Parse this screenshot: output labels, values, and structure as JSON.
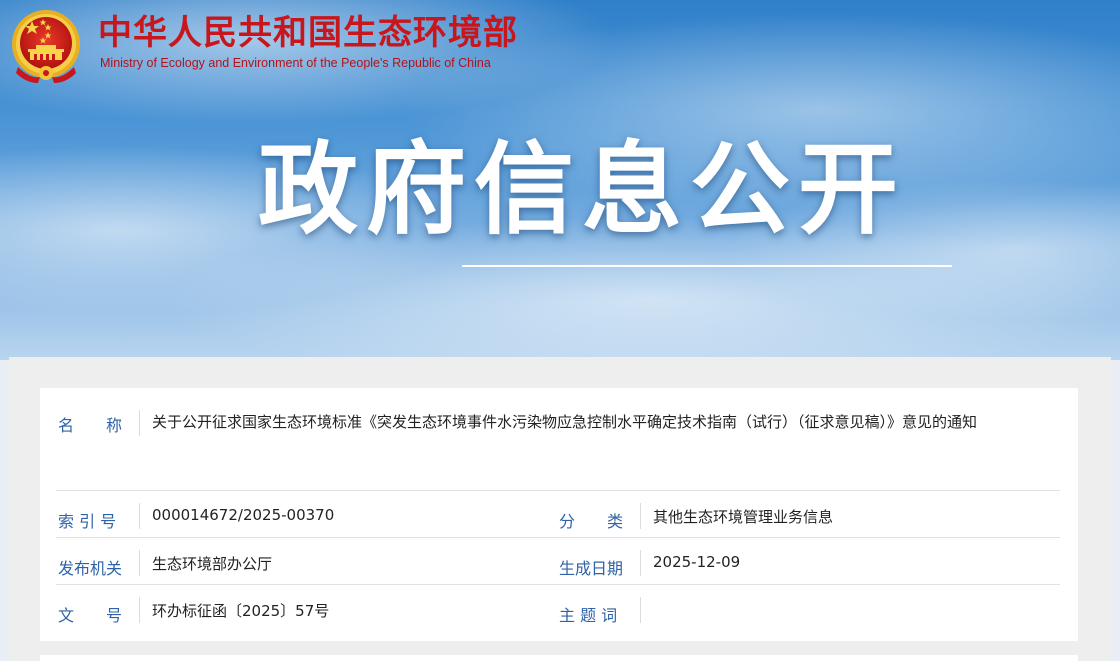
{
  "header": {
    "ministry_cn": "中华人民共和国生态环境部",
    "ministry_en": "Ministry of Ecology and Environment of the People's Republic of China",
    "emblem_icon": "national-emblem-icon",
    "brand_color": "#c8161d"
  },
  "hero": {
    "title": "政府信息公开"
  },
  "info": {
    "name_label": "名　　称",
    "name_value": "关于公开征求国家生态环境标准《突发生态环境事件水污染物应急控制水平确定技术指南（试行）（征求意见稿）》意见的通知",
    "index_label": "索 引 号",
    "index_value": "000014672/2025-00370",
    "category_label": "分　　类",
    "category_value": "其他生态环境管理业务信息",
    "issuer_label": "发布机关",
    "issuer_value": "生态环境部办公厅",
    "date_label": "生成日期",
    "date_value": "2025-12-09",
    "docno_label": "文　　号",
    "docno_value": "环办标征函〔2025〕57号",
    "keywords_label": "主 题 词",
    "keywords_value": "",
    "label_color": "#2f63a8"
  }
}
